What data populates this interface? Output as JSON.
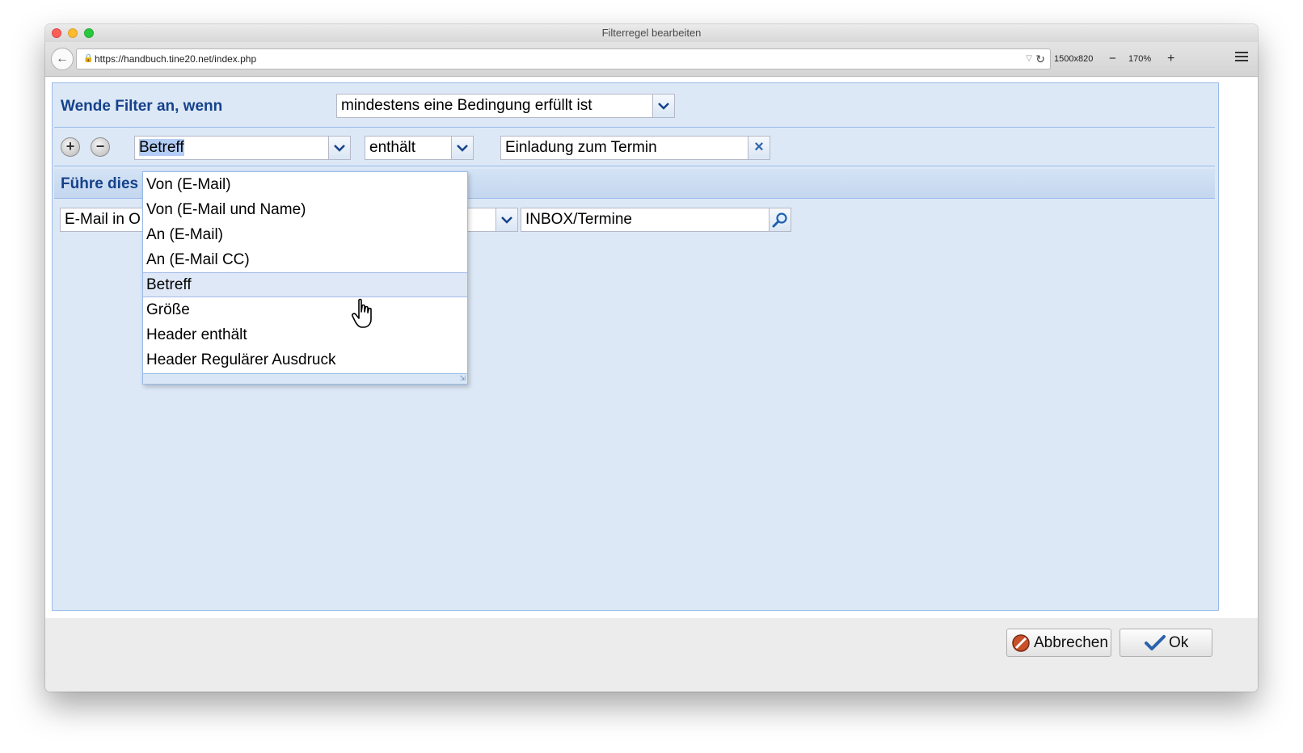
{
  "window": {
    "title": "Filterregel bearbeiten"
  },
  "browser": {
    "url": "https://handbuch.tine20.net/index.php",
    "viewport_size": "1500x820",
    "zoom_out": "−",
    "zoom_level": "170%",
    "zoom_in": "+"
  },
  "filter": {
    "condition_label": "Wende Filter an, wenn",
    "condition_value": "mindestens eine Bedingung erfüllt ist"
  },
  "rule": {
    "field_value": "Betreff",
    "operator_value": "enthält",
    "text_value": "Einladung zum Termin"
  },
  "actions": {
    "section_label": "Führe dies",
    "action_value": "E-Mail in O",
    "folder_value": "INBOX/Termine"
  },
  "dropdown": {
    "items": [
      "Von (E-Mail)",
      "Von (E-Mail und Name)",
      "An (E-Mail)",
      "An (E-Mail CC)",
      "Betreff",
      "Größe",
      "Header enthält",
      "Header Regulärer Ausdruck"
    ],
    "selected_index": 4
  },
  "buttons": {
    "cancel": "Abbrechen",
    "ok": "Ok"
  }
}
